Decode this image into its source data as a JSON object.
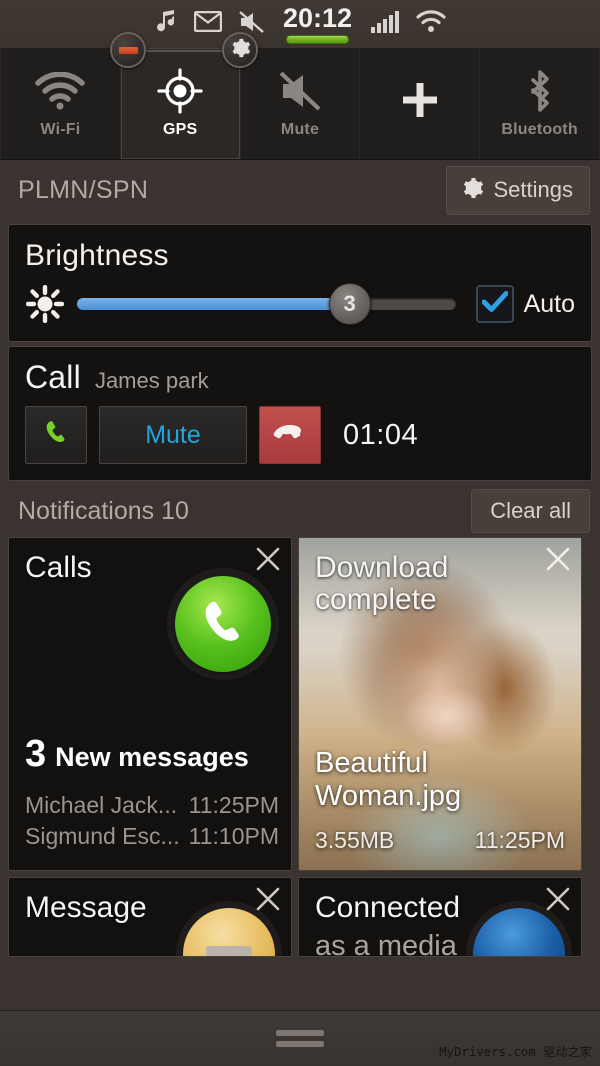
{
  "status_bar": {
    "time": "20:12",
    "icons_left": [
      "music-note-icon",
      "envelope-icon",
      "mute-slash-icon"
    ],
    "icons_right": [
      "signal-bars-icon",
      "wifi-icon"
    ],
    "battery_color": "#76b622",
    "badges": [
      {
        "name": "minus-badge",
        "icon": "minus-icon",
        "color": "#d4511f"
      },
      {
        "name": "gear-badge",
        "icon": "gear-icon"
      }
    ]
  },
  "quick_toggles": [
    {
      "label": "Wi-Fi",
      "icon": "wifi-icon",
      "active": false
    },
    {
      "label": "GPS",
      "icon": "gps-target-icon",
      "active": true
    },
    {
      "label": "Mute",
      "icon": "mute-slash-icon",
      "active": false
    },
    {
      "label": "",
      "icon": "plus-icon",
      "active": false
    },
    {
      "label": "Bluetooth",
      "icon": "bluetooth-icon",
      "active": false
    }
  ],
  "plmn": {
    "carrier": "PLMN/SPN",
    "settings_label": "Settings",
    "settings_icon": "gear-icon"
  },
  "brightness": {
    "title": "Brightness",
    "icon": "brightness-sun-icon",
    "level_label": "3",
    "fill_percent": 72,
    "auto_label": "Auto",
    "auto_checked": true,
    "accent": "#4c8fd6"
  },
  "call": {
    "title": "Call",
    "contact": "James park",
    "call_icon": "phone-handset-icon",
    "mute_label": "Mute",
    "mute_color": "#21a5de",
    "end_icon": "phone-hangup-icon",
    "end_color": "#b5474a",
    "timer": "01:04"
  },
  "notifications": {
    "header": "Notifications 10",
    "clear_label": "Clear all",
    "cards": [
      {
        "name": "calls-card",
        "title": "Calls",
        "icon": "green-phone-circle-icon",
        "count": "3",
        "count_text": "New messages",
        "items": [
          {
            "sender": "Michael Jack...",
            "time": "11:25PM"
          },
          {
            "sender": "Sigmund Esc...",
            "time": "11:10PM"
          }
        ],
        "close_icon": "close-icon"
      },
      {
        "name": "download-card",
        "title": "Download complete",
        "filename": "Beautiful Woman.jpg",
        "size": "3.55MB",
        "time": "11:25PM",
        "thumbnail": "woman-portrait-photo",
        "close_icon": "close-icon"
      },
      {
        "name": "message-card",
        "title": "Message",
        "icon": "orange-message-circle-icon",
        "close_icon": "close-icon"
      },
      {
        "name": "connected-card",
        "title": "Connected",
        "subtitle": "as a media",
        "icon": "blue-usb-circle-icon",
        "close_icon": "close-icon"
      }
    ]
  },
  "handle": {
    "icon": "drag-handle-icon"
  },
  "watermark": "MyDrivers.com 驱动之家"
}
